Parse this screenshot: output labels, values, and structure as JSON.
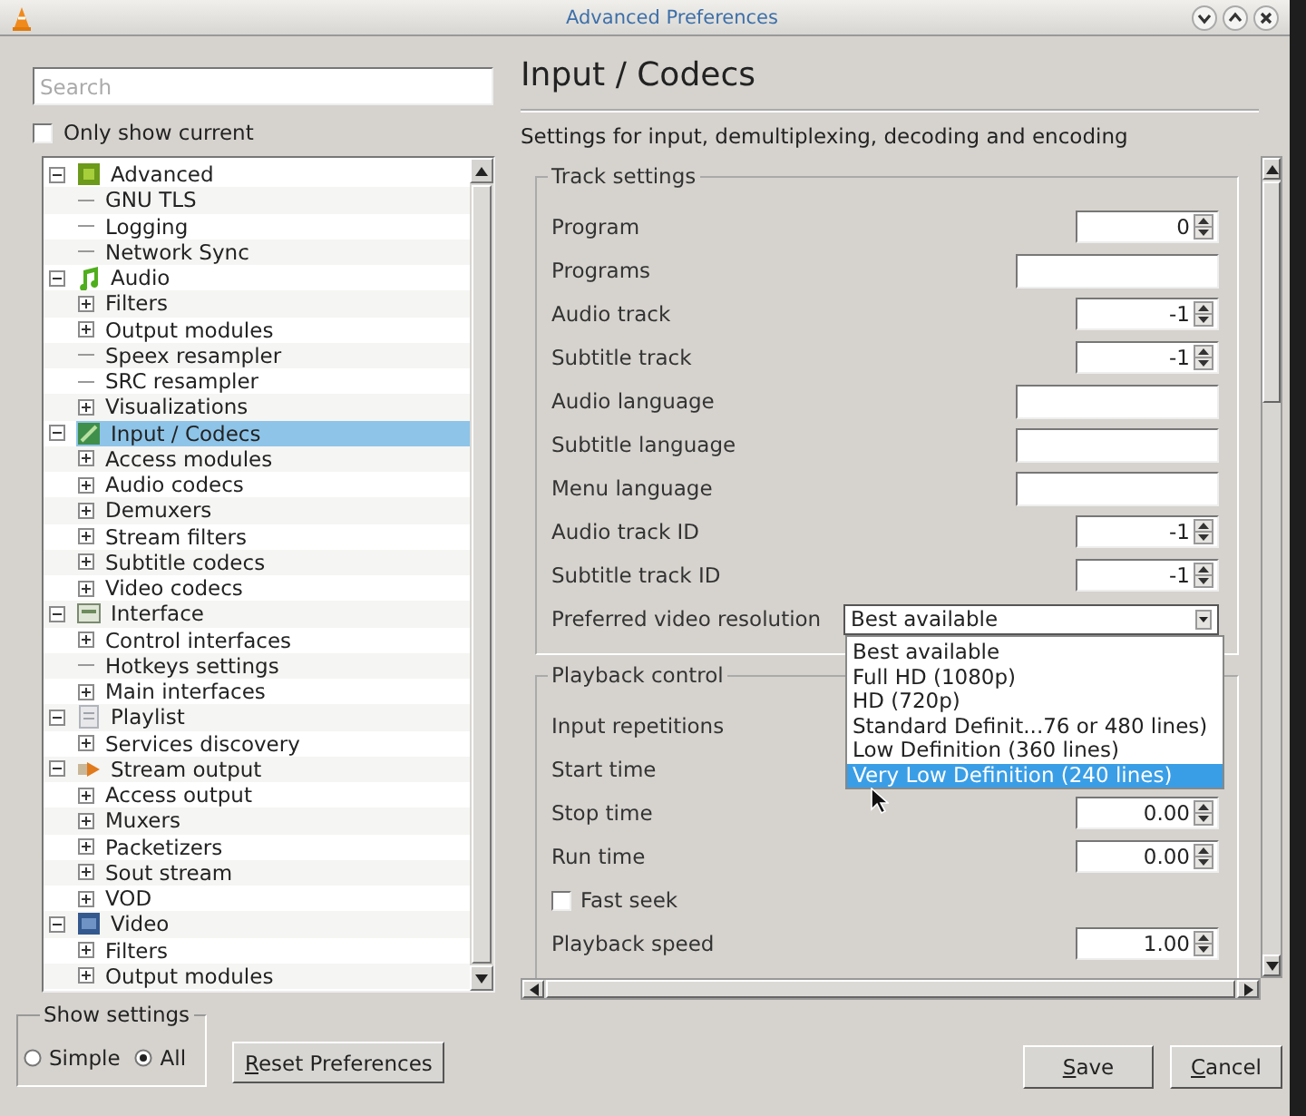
{
  "window": {
    "title": "Advanced Preferences"
  },
  "search": {
    "placeholder": "Search"
  },
  "only_show_current": {
    "label": "Only show current",
    "checked": false
  },
  "tree": {
    "items": [
      {
        "label": "Advanced",
        "kind": "advanced",
        "expanded": true,
        "selected": false,
        "children": [
          {
            "label": "GNU TLS",
            "selected": false
          },
          {
            "label": "Logging",
            "selected": false
          },
          {
            "label": "Network Sync",
            "selected": false
          }
        ]
      },
      {
        "label": "Audio",
        "kind": "audio",
        "expanded": true,
        "selected": false,
        "children": [
          {
            "label": "Filters",
            "expanded": false,
            "selected": false
          },
          {
            "label": "Output modules",
            "expanded": false,
            "selected": false
          },
          {
            "label": "Speex resampler",
            "selected": false
          },
          {
            "label": "SRC resampler",
            "selected": false
          },
          {
            "label": "Visualizations",
            "expanded": false,
            "selected": false
          }
        ]
      },
      {
        "label": "Input / Codecs",
        "kind": "input",
        "expanded": true,
        "selected": true,
        "children": [
          {
            "label": "Access modules",
            "expanded": false,
            "selected": false
          },
          {
            "label": "Audio codecs",
            "expanded": false,
            "selected": false
          },
          {
            "label": "Demuxers",
            "expanded": false,
            "selected": false
          },
          {
            "label": "Stream filters",
            "expanded": false,
            "selected": false
          },
          {
            "label": "Subtitle codecs",
            "expanded": false,
            "selected": false
          },
          {
            "label": "Video codecs",
            "expanded": false,
            "selected": false
          }
        ]
      },
      {
        "label": "Interface",
        "kind": "interface",
        "expanded": true,
        "selected": false,
        "children": [
          {
            "label": "Control interfaces",
            "expanded": false,
            "selected": false
          },
          {
            "label": "Hotkeys settings",
            "selected": false
          },
          {
            "label": "Main interfaces",
            "expanded": false,
            "selected": false
          }
        ]
      },
      {
        "label": "Playlist",
        "kind": "playlist",
        "expanded": true,
        "selected": false,
        "children": [
          {
            "label": "Services discovery",
            "expanded": false,
            "selected": false
          }
        ]
      },
      {
        "label": "Stream output",
        "kind": "stream",
        "expanded": true,
        "selected": false,
        "children": [
          {
            "label": "Access output",
            "expanded": false,
            "selected": false
          },
          {
            "label": "Muxers",
            "expanded": false,
            "selected": false
          },
          {
            "label": "Packetizers",
            "expanded": false,
            "selected": false
          },
          {
            "label": "Sout stream",
            "expanded": false,
            "selected": false
          },
          {
            "label": "VOD",
            "expanded": false,
            "selected": false
          }
        ]
      },
      {
        "label": "Video",
        "kind": "video",
        "expanded": true,
        "selected": false,
        "children": [
          {
            "label": "Filters",
            "expanded": false,
            "selected": false
          },
          {
            "label": "Output modules",
            "expanded": false,
            "selected": false
          }
        ]
      }
    ]
  },
  "show_settings": {
    "title": "Show settings",
    "options": [
      {
        "label": "Simple",
        "selected": false
      },
      {
        "label": "All",
        "selected": true
      }
    ]
  },
  "reset_button": "Reset Preferences",
  "panel": {
    "title": "Input / Codecs",
    "description": "Settings for input, demultiplexing, decoding and encoding"
  },
  "groups": [
    {
      "title": "Track settings",
      "rows": [
        {
          "label": "Program",
          "kind": "spin",
          "value": "0"
        },
        {
          "label": "Programs",
          "kind": "text"
        },
        {
          "label": "Audio track",
          "kind": "spin",
          "value": "-1"
        },
        {
          "label": "Subtitle track",
          "kind": "spin",
          "value": "-1"
        },
        {
          "label": "Audio language",
          "kind": "text"
        },
        {
          "label": "Subtitle language",
          "kind": "text"
        },
        {
          "label": "Menu language",
          "kind": "text"
        },
        {
          "label": "Audio track ID",
          "kind": "spin",
          "value": "-1"
        },
        {
          "label": "Subtitle track ID",
          "kind": "spin",
          "value": "-1"
        },
        {
          "label": "Preferred video resolution",
          "kind": "combo",
          "value": "Best available",
          "expanded": true,
          "options": [
            {
              "label": "Best available",
              "highlighted": false
            },
            {
              "label": "Full HD (1080p)",
              "highlighted": false
            },
            {
              "label": "HD (720p)",
              "highlighted": false
            },
            {
              "label": "Standard Definit...76 or 480 lines)",
              "highlighted": false
            },
            {
              "label": "Low Definition (360 lines)",
              "highlighted": false
            },
            {
              "label": "Very Low Definition (240 lines)",
              "highlighted": true
            }
          ]
        }
      ]
    },
    {
      "title": "Playback control",
      "rows": [
        {
          "label": "Input repetitions",
          "kind": "covered"
        },
        {
          "label": "Start time",
          "kind": "covered"
        },
        {
          "label": "Stop time",
          "kind": "spin",
          "value": "0.00"
        },
        {
          "label": "Run time",
          "kind": "spin",
          "value": "0.00"
        },
        {
          "label": "Fast seek",
          "kind": "check",
          "checked": false
        },
        {
          "label": "Playback speed",
          "kind": "spin",
          "value": "1.00"
        }
      ]
    }
  ],
  "buttons": [
    {
      "label": "Save"
    },
    {
      "label": "Cancel"
    }
  ]
}
